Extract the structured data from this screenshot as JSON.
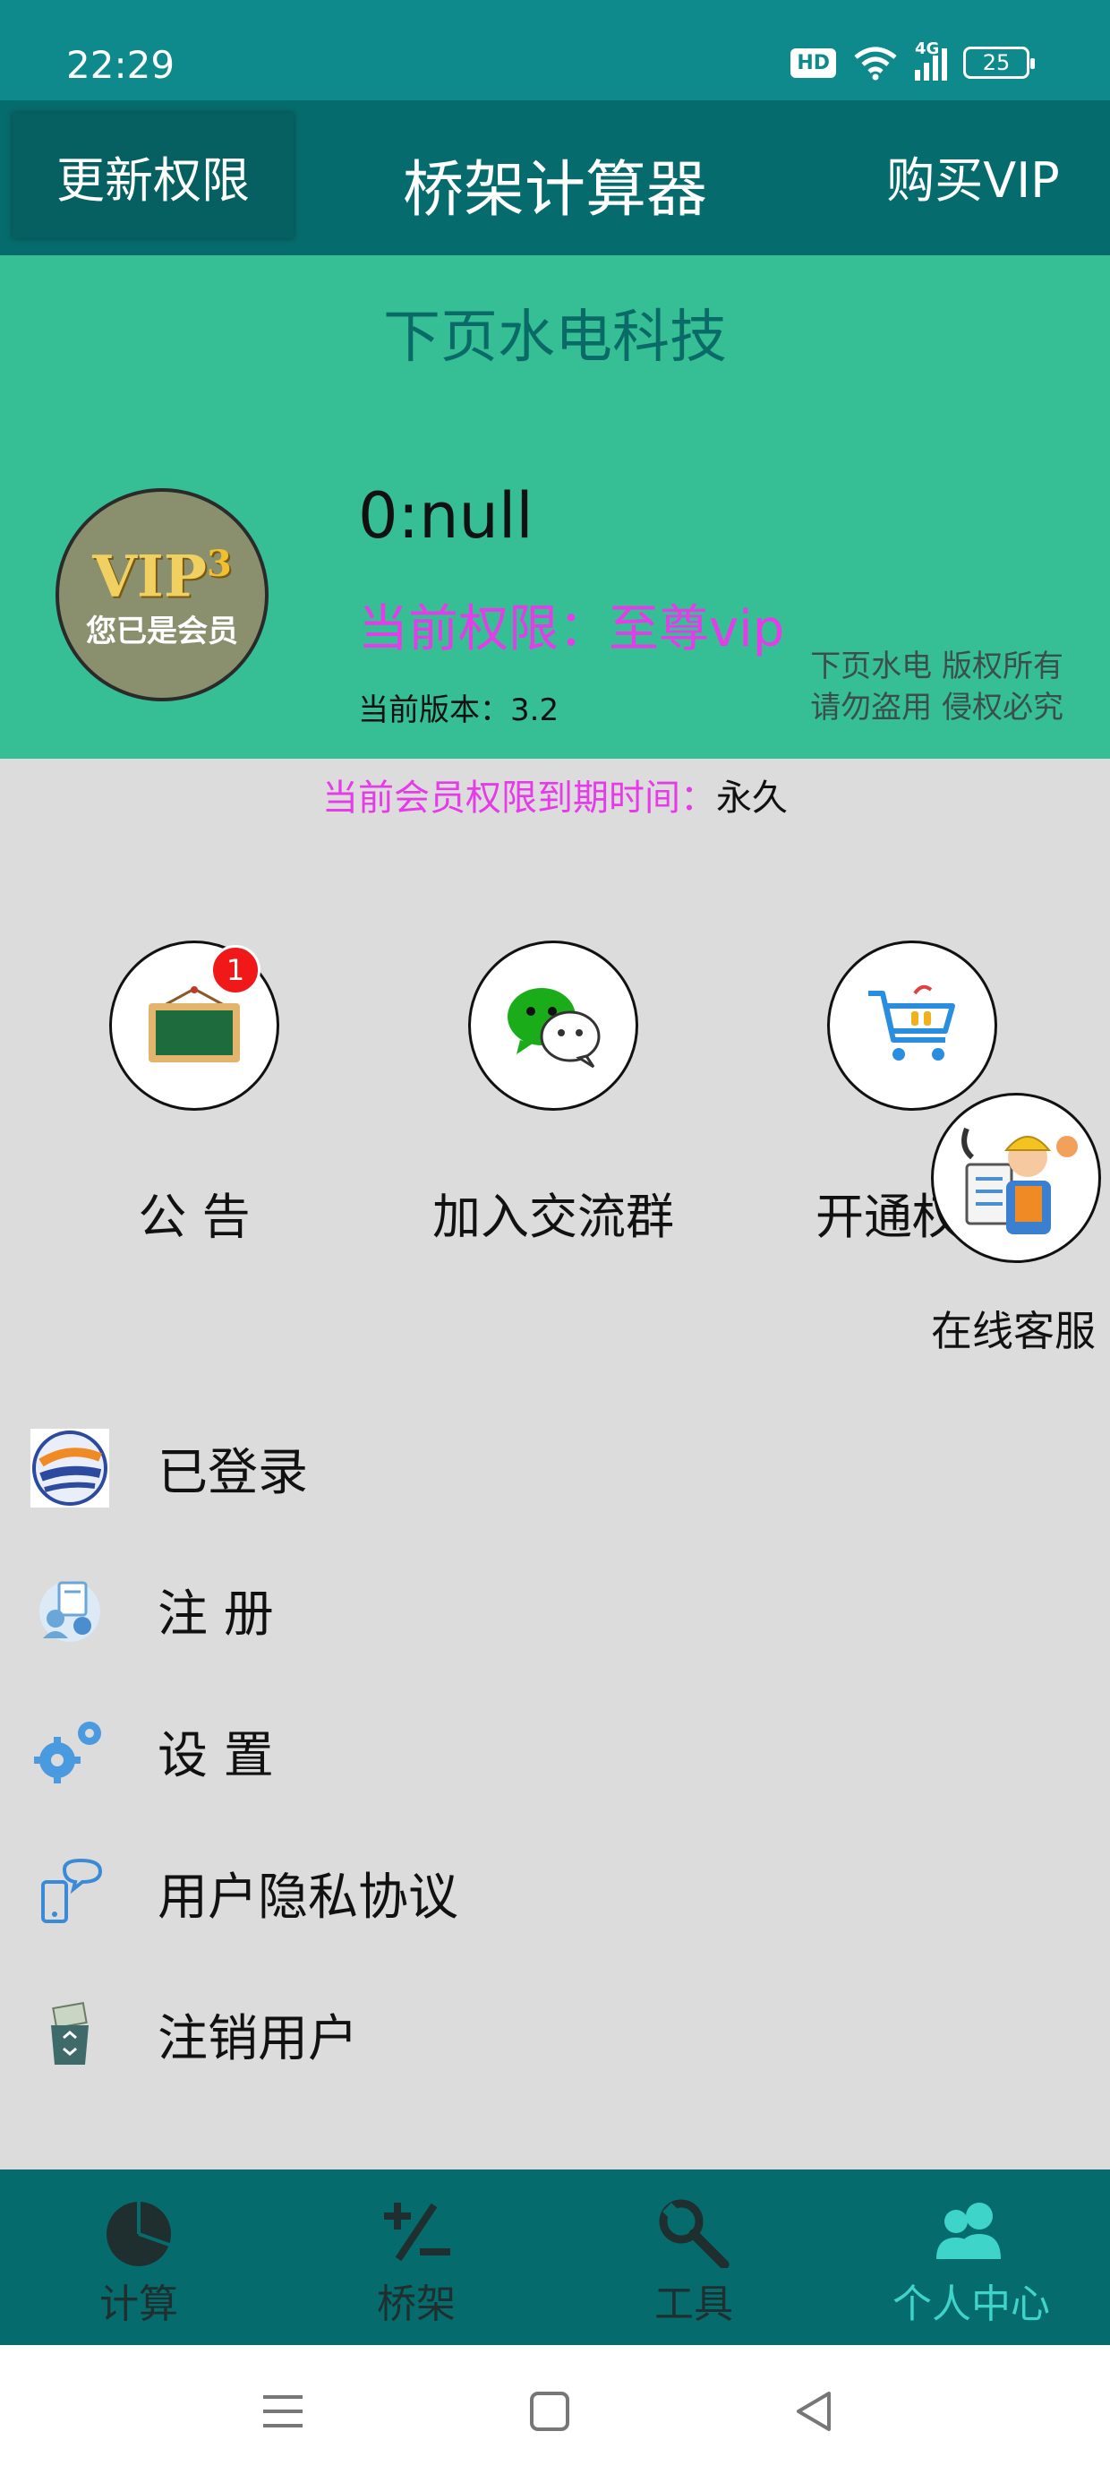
{
  "status_bar": {
    "time": "22:29",
    "hd": "HD",
    "signal": "4G",
    "battery": "25"
  },
  "title_bar": {
    "left_button": "更新权限",
    "title": "桥架计算器",
    "right_button": "购买VIP"
  },
  "profile": {
    "company": "下页水电科技",
    "avatar_vip": "VIP",
    "avatar_level": "3",
    "avatar_caption": "您已是会员",
    "username": "0:null",
    "permission": "当前权限：至尊vip",
    "version": "当前版本：3.2",
    "copyright_line1": "下页水电  版权所有",
    "copyright_line2": "请勿盗用  侵权必究"
  },
  "expiry": {
    "label": "当前会员权限到期时间：",
    "value": "永久"
  },
  "shortcuts": [
    {
      "label": "公 告",
      "badge": "1",
      "icon": "chalkboard-icon"
    },
    {
      "label": "加入交流群",
      "icon": "wechat-icon"
    },
    {
      "label": "开通权限",
      "icon": "shopping-cart-icon"
    }
  ],
  "service": {
    "label": "在线客服",
    "icon": "customer-service-worker-icon"
  },
  "menu": [
    {
      "label": "已登录",
      "icon": "app-logo-icon"
    },
    {
      "label": "注 册",
      "icon": "register-user-icon"
    },
    {
      "label": "设 置",
      "icon": "gears-icon"
    },
    {
      "label": "用户隐私协议",
      "icon": "privacy-chat-icon"
    },
    {
      "label": "注销用户",
      "icon": "recycle-bin-icon"
    }
  ],
  "bottom_nav": [
    {
      "label": "计算",
      "icon": "pie-chart-icon"
    },
    {
      "label": "桥架",
      "icon": "plus-minus-icon"
    },
    {
      "label": "工具",
      "icon": "wrench-icon"
    },
    {
      "label": "个人中心",
      "icon": "users-icon",
      "active": true
    }
  ],
  "colors": {
    "statusbar": "#0e8a8c",
    "titlebar": "#066b6c",
    "header": "#36bf94",
    "accent": "#e53be8",
    "active_nav": "#3fd4ca"
  }
}
